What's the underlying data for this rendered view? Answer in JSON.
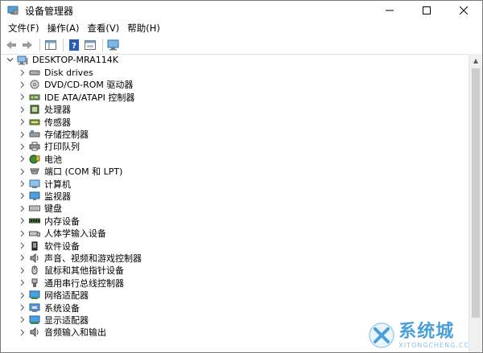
{
  "window": {
    "title": "设备管理器"
  },
  "menu": [
    "文件(F)",
    "操作(A)",
    "查看(V)",
    "帮助(H)"
  ],
  "tree": {
    "root": "DESKTOP-MRA114K",
    "items": [
      {
        "label": "Disk drives",
        "icon": "disk-drive-icon"
      },
      {
        "label": "DVD/CD-ROM 驱动器",
        "icon": "dvd-drive-icon"
      },
      {
        "label": "IDE ATA/ATAPI 控制器",
        "icon": "ide-controller-icon"
      },
      {
        "label": "处理器",
        "icon": "processor-icon"
      },
      {
        "label": "传感器",
        "icon": "sensor-icon"
      },
      {
        "label": "存储控制器",
        "icon": "storage-controller-icon"
      },
      {
        "label": "打印队列",
        "icon": "printer-icon"
      },
      {
        "label": "电池",
        "icon": "battery-icon"
      },
      {
        "label": "端口 (COM 和 LPT)",
        "icon": "port-icon"
      },
      {
        "label": "计算机",
        "icon": "computer-icon"
      },
      {
        "label": "监视器",
        "icon": "monitor-icon"
      },
      {
        "label": "键盘",
        "icon": "keyboard-icon"
      },
      {
        "label": "内存设备",
        "icon": "memory-icon"
      },
      {
        "label": "人体学输入设备",
        "icon": "hid-icon"
      },
      {
        "label": "软件设备",
        "icon": "software-device-icon"
      },
      {
        "label": "声音、视频和游戏控制器",
        "icon": "sound-icon"
      },
      {
        "label": "鼠标和其他指针设备",
        "icon": "mouse-icon"
      },
      {
        "label": "通用串行总线控制器",
        "icon": "usb-icon"
      },
      {
        "label": "网络适配器",
        "icon": "network-adapter-icon"
      },
      {
        "label": "系统设备",
        "icon": "system-device-icon"
      },
      {
        "label": "显示适配器",
        "icon": "display-adapter-icon"
      },
      {
        "label": "音频输入和输出",
        "icon": "audio-io-icon"
      }
    ]
  },
  "watermark": {
    "cn": "系统城",
    "en": "XITONGCHENG.CC"
  }
}
